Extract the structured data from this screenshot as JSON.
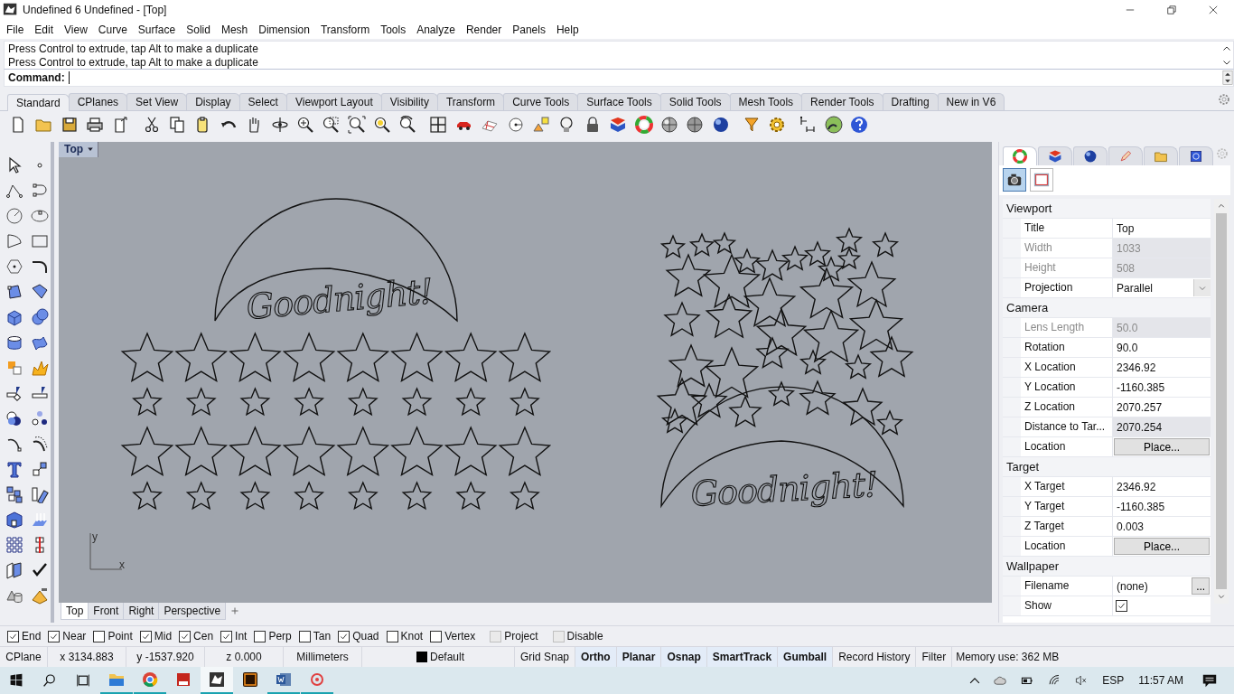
{
  "window": {
    "title": "Undefined 6 Undefined - [Top]"
  },
  "menu": [
    "File",
    "Edit",
    "View",
    "Curve",
    "Surface",
    "Solid",
    "Mesh",
    "Dimension",
    "Transform",
    "Tools",
    "Analyze",
    "Render",
    "Panels",
    "Help"
  ],
  "command_history": [
    "Press Control to extrude, tap Alt to make a duplicate",
    "Press Control to extrude, tap Alt to make a duplicate"
  ],
  "command_prompt": {
    "label": "Command:"
  },
  "toolbar_tabs": [
    {
      "label": "Standard",
      "selected": true
    },
    {
      "label": "CPlanes",
      "selected": false
    },
    {
      "label": "Set View",
      "selected": false
    },
    {
      "label": "Display",
      "selected": false
    },
    {
      "label": "Select",
      "selected": false
    },
    {
      "label": "Viewport Layout",
      "selected": false
    },
    {
      "label": "Visibility",
      "selected": false
    },
    {
      "label": "Transform",
      "selected": false
    },
    {
      "label": "Curve Tools",
      "selected": false
    },
    {
      "label": "Surface Tools",
      "selected": false
    },
    {
      "label": "Solid Tools",
      "selected": false
    },
    {
      "label": "Mesh Tools",
      "selected": false
    },
    {
      "label": "Render Tools",
      "selected": false
    },
    {
      "label": "Drafting",
      "selected": false
    },
    {
      "label": "New in V6",
      "selected": false
    }
  ],
  "viewport": {
    "title": "Top",
    "left_design": {
      "text": "Goodnight!"
    },
    "right_design": {
      "text": "Goodnight!"
    },
    "axis": {
      "x_label": "x",
      "y_label": "y"
    }
  },
  "viewport_tabs": [
    {
      "label": "Top",
      "selected": true
    },
    {
      "label": "Front",
      "selected": false
    },
    {
      "label": "Right",
      "selected": false
    },
    {
      "label": "Perspective",
      "selected": false
    }
  ],
  "properties": {
    "panel_tabs": [
      {
        "selected": true
      },
      {
        "selected": false
      },
      {
        "selected": false
      },
      {
        "selected": false
      },
      {
        "selected": false
      },
      {
        "selected": false
      }
    ],
    "sub_tabs": [
      {
        "selected": true
      },
      {
        "selected": false
      }
    ],
    "sections": [
      {
        "title": "Viewport",
        "rows": [
          {
            "label": "Title",
            "value": "Top",
            "kind": "text",
            "disabled": false
          },
          {
            "label": "Width",
            "value": "1033",
            "kind": "readonly",
            "disabled": true
          },
          {
            "label": "Height",
            "value": "508",
            "kind": "readonly",
            "disabled": true
          },
          {
            "label": "Projection",
            "value": "Parallel",
            "kind": "dropdown",
            "disabled": false
          }
        ]
      },
      {
        "title": "Camera",
        "rows": [
          {
            "label": "Lens Length",
            "value": "50.0",
            "kind": "readonly",
            "disabled": true
          },
          {
            "label": "Rotation",
            "value": "90.0",
            "kind": "text",
            "disabled": false
          },
          {
            "label": "X Location",
            "value": "2346.92",
            "kind": "text",
            "disabled": false
          },
          {
            "label": "Y Location",
            "value": "-1160.385",
            "kind": "text",
            "disabled": false
          },
          {
            "label": "Z Location",
            "value": "2070.257",
            "kind": "text",
            "disabled": false
          },
          {
            "label": "Distance to Tar...",
            "value": "2070.254",
            "kind": "readonly",
            "disabled": false
          },
          {
            "label": "Location",
            "value": "Place...",
            "kind": "button",
            "disabled": false
          }
        ]
      },
      {
        "title": "Target",
        "rows": [
          {
            "label": "X Target",
            "value": "2346.92",
            "kind": "text",
            "disabled": false
          },
          {
            "label": "Y Target",
            "value": "-1160.385",
            "kind": "text",
            "disabled": false
          },
          {
            "label": "Z Target",
            "value": "0.003",
            "kind": "text",
            "disabled": false
          },
          {
            "label": "Location",
            "value": "Place...",
            "kind": "button",
            "disabled": false
          }
        ]
      },
      {
        "title": "Wallpaper",
        "rows": [
          {
            "label": "Filename",
            "value": "(none)",
            "button_label": "...",
            "kind": "browse",
            "disabled": false
          },
          {
            "label": "Show",
            "kind": "check",
            "checked": true,
            "disabled": false
          }
        ]
      }
    ]
  },
  "osnaps": [
    {
      "label": "End",
      "checked": true,
      "disabled": false
    },
    {
      "label": "Near",
      "checked": true,
      "disabled": false
    },
    {
      "label": "Point",
      "checked": false,
      "disabled": false
    },
    {
      "label": "Mid",
      "checked": true,
      "disabled": false
    },
    {
      "label": "Cen",
      "checked": true,
      "disabled": false
    },
    {
      "label": "Int",
      "checked": true,
      "disabled": false
    },
    {
      "label": "Perp",
      "checked": false,
      "disabled": false
    },
    {
      "label": "Tan",
      "checked": false,
      "disabled": false
    },
    {
      "label": "Quad",
      "checked": true,
      "disabled": false
    },
    {
      "label": "Knot",
      "checked": false,
      "disabled": false
    },
    {
      "label": "Vertex",
      "checked": false,
      "disabled": false
    },
    {
      "label": "Project",
      "checked": false,
      "disabled": true
    },
    {
      "label": "Disable",
      "checked": false,
      "disabled": true
    }
  ],
  "status_bar": [
    {
      "text": "CPlane",
      "kind": "label"
    },
    {
      "text": "x 3134.883",
      "kind": "coord"
    },
    {
      "text": "y -1537.920",
      "kind": "coord"
    },
    {
      "text": "z 0.000",
      "kind": "coord"
    },
    {
      "text": "Millimeters",
      "kind": "units"
    },
    {
      "text": "Default",
      "kind": "layer"
    },
    {
      "text": "Grid Snap",
      "kind": "toggle",
      "on": false
    },
    {
      "text": "Ortho",
      "kind": "toggle",
      "on": true
    },
    {
      "text": "Planar",
      "kind": "toggle",
      "on": true
    },
    {
      "text": "Osnap",
      "kind": "toggle",
      "on": true
    },
    {
      "text": "SmartTrack",
      "kind": "toggle",
      "on": true
    },
    {
      "text": "Gumball",
      "kind": "toggle",
      "on": true
    },
    {
      "text": "Record History",
      "kind": "toggle",
      "on": false
    },
    {
      "text": "Filter",
      "kind": "toggle",
      "on": false
    },
    {
      "text": "Memory use: 362 MB",
      "kind": "info"
    }
  ],
  "taskbar": {
    "apps": [
      {
        "running": true,
        "active": false
      },
      {
        "running": true,
        "active": false
      },
      {
        "running": false,
        "active": false
      },
      {
        "running": true,
        "active": true
      },
      {
        "running": false,
        "active": false
      },
      {
        "running": true,
        "active": false
      },
      {
        "running": true,
        "active": false
      }
    ],
    "language": "ESP",
    "time": "11:57 AM"
  }
}
